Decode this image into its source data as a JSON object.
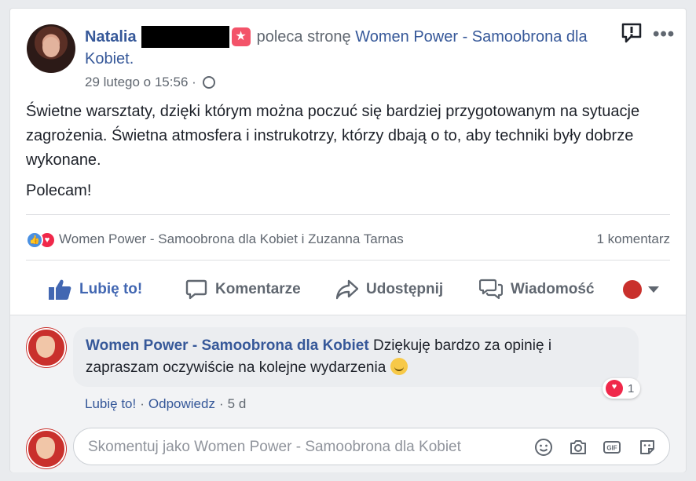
{
  "post": {
    "author": "Natalia",
    "verb": "poleca stronę",
    "page_name": "Women Power - Samoobrona dla Kobiet.",
    "timestamp": "29 lutego o 15:56",
    "separator": "·",
    "body": [
      "Świetne warsztaty, dzięki którym można poczuć się bardziej przygotowanym na sytuacje zagrożenia. Świetna atmosfera i instrukotrzy, którzy dbają o to, aby techniki były dobrze wykonane.",
      "Polecam!"
    ]
  },
  "reactions": {
    "names": "Women Power - Samoobrona dla Kobiet i Zuzanna Tarnas",
    "comment_count": "1 komentarz"
  },
  "actions": {
    "like": "Lubię to!",
    "comment": "Komentarze",
    "share": "Udostępnij",
    "message": "Wiadomość"
  },
  "comment": {
    "author": "Women Power - Samoobrona dla Kobiet",
    "text": "Dziękuję bardzo za opinię i zapraszam oczywiście na kolejne wydarzenia",
    "like_link": "Lubię to!",
    "reply_link": "Odpowiedz",
    "age": "5 d",
    "reaction_count": "1"
  },
  "composer": {
    "placeholder": "Skomentuj jako Women Power - Samoobrona dla Kobiet"
  },
  "colors": {
    "link": "#365899",
    "like_blue": "#4267b2",
    "love_red": "#f0284a",
    "muted": "#606770"
  }
}
